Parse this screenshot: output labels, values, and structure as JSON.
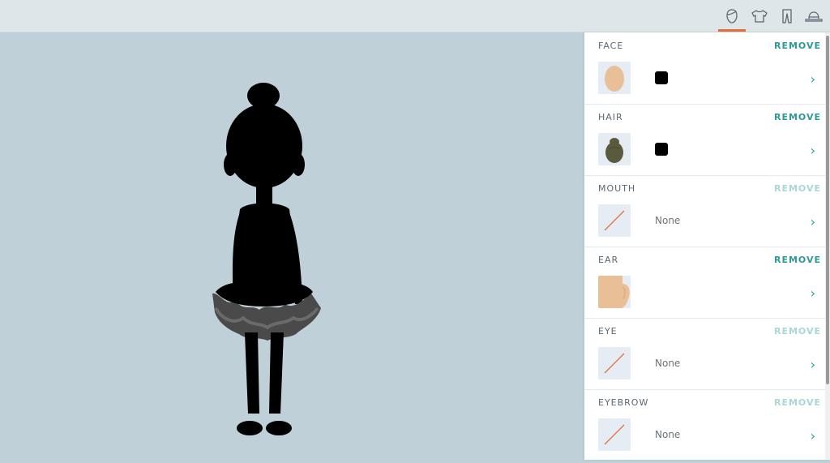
{
  "tabs": [
    {
      "name": "head-icon",
      "active": true
    },
    {
      "name": "shirt-icon",
      "active": false
    },
    {
      "name": "pants-icon",
      "active": false
    },
    {
      "name": "hat-icon",
      "active": false
    }
  ],
  "sections": [
    {
      "key": "face",
      "title": "FACE",
      "remove": "REMOVE",
      "remove_enabled": true,
      "thumb": "face-thumbnail",
      "swatch": "#000000",
      "value": ""
    },
    {
      "key": "hair",
      "title": "HAIR",
      "remove": "REMOVE",
      "remove_enabled": true,
      "thumb": "hair-bun-thumbnail",
      "swatch": "#000000",
      "value": ""
    },
    {
      "key": "mouth",
      "title": "MOUTH",
      "remove": "REMOVE",
      "remove_enabled": false,
      "thumb": "none-thumbnail",
      "value": "None"
    },
    {
      "key": "ear",
      "title": "EAR",
      "remove": "REMOVE",
      "remove_enabled": true,
      "thumb": "ear-thumbnail",
      "value": ""
    },
    {
      "key": "eye",
      "title": "EYE",
      "remove": "REMOVE",
      "remove_enabled": false,
      "thumb": "none-thumbnail",
      "value": "None"
    },
    {
      "key": "eyebrow",
      "title": "EYEBROW",
      "remove": "REMOVE",
      "remove_enabled": false,
      "thumb": "none-thumbnail",
      "value": "None"
    }
  ],
  "colors": {
    "accent": "#e2703a",
    "teal": "#2d9a9a",
    "stage": "#bfd0d8",
    "skin": "#e9bf98",
    "hair": "#5a5a3c"
  }
}
